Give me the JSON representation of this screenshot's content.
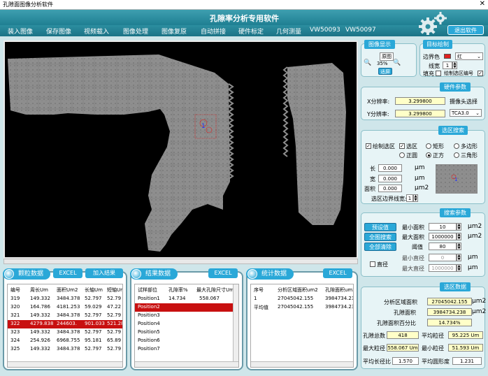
{
  "window": {
    "title": "孔隙面图像分析软件",
    "close": "✕"
  },
  "header": {
    "title": "孔隙率分析专用软件"
  },
  "menu": [
    "装入图像",
    "保存图像",
    "视频载入",
    "图像处理",
    "图像复原",
    "自动拼接",
    "硬件标定",
    "几何测量",
    "VW50093",
    "VW50097"
  ],
  "exit_button": "退出软件",
  "image_display": {
    "title": "图像显示",
    "orig": "原图",
    "zoom": "35%",
    "fit": "适屏"
  },
  "target_draw": {
    "title": "目标绘制",
    "border_color_label": "边界色",
    "border_color_value": "红",
    "border_color": "#e02020",
    "line_width_label": "线宽",
    "line_width_value": "1",
    "fill_label": "填充",
    "fill_checked": false,
    "draw_region_id_label": "绘制选区编号",
    "draw_region_id_checked": true
  },
  "hardware": {
    "title": "硬件参数",
    "x_res_label": "X分辨率:",
    "x_res": "3.299800",
    "y_res_label": "Y分辨率:",
    "y_res": "3.299800",
    "camera_label": "摄像头选择",
    "camera_value": "TCA3.0"
  },
  "region_select": {
    "title": "选区搜索",
    "draw_region": "绘制选区",
    "draw_region_checked": true,
    "region": "选区",
    "region_checked": true,
    "rect": "矩形",
    "polygon": "多边形",
    "circle": "正圆",
    "square": "正方",
    "triangle": "三角形",
    "length_label": "长",
    "length": "0.000",
    "width_label": "宽",
    "width": "0.000",
    "area_label": "面积",
    "area": "0.000",
    "unit_um": "μm",
    "unit_um2": "μm2",
    "border_line_label": "选区边界线宽:",
    "border_line_value": "1"
  },
  "search_params": {
    "title": "搜索参数",
    "preset_btn": "预设值",
    "full_search_btn": "全图搜索",
    "clear_btn": "全部清除",
    "min_area_label": "最小面积",
    "min_area": "10",
    "max_area_label": "最大面积",
    "max_area": "1000000",
    "threshold_label": "阈值",
    "threshold": "80",
    "diameter_label": "直径",
    "diameter_checked": false,
    "min_diam_label": "最小直径",
    "min_diam": "0",
    "max_diam_label": "最大直径",
    "max_diam": "1000000",
    "unit_um2": "μm2",
    "unit_um": "μm"
  },
  "region_data": {
    "title": "选区数据",
    "analysis_area_label": "分析区域面积",
    "analysis_area": "27045042.155",
    "pore_area_label": "孔隙面积",
    "pore_area": "3984734.238",
    "pore_pct_label": "孔隙面积百分比",
    "pore_pct": "14.734%",
    "pore_count_label": "孔隙总数",
    "pore_count": "418",
    "avg_size_label": "平均粒径",
    "avg_size": "95.225 Um",
    "max_size_label": "最大粒径",
    "max_size": "558.067 Um",
    "min_size_label": "最小粒径",
    "min_size": "51.593 Um",
    "avg_aspect_label": "平均长径比",
    "avg_aspect": "1.570",
    "avg_round_label": "平均圆形度",
    "avg_round": "1.231",
    "unit_um2": "μm2"
  },
  "particle_data": {
    "title": "颗粒数据",
    "excel_btn": "EXCEL",
    "add_btn": "加入结果",
    "headers": [
      "编号",
      "周长Um",
      "面积Um2",
      "长轴Um",
      "短轴Um"
    ],
    "rows": [
      [
        "319",
        "149.332",
        "3484.378",
        "52.797",
        "52.79"
      ],
      [
        "320",
        "164.786",
        "4181.253",
        "59.029",
        "47.22"
      ],
      [
        "321",
        "149.332",
        "3484.378",
        "52.797",
        "52.79"
      ],
      [
        "322",
        "4279.838",
        "244603.",
        "901.033",
        "521.28"
      ],
      [
        "323",
        "149.332",
        "3484.378",
        "52.797",
        "52.79"
      ],
      [
        "324",
        "254.926",
        "6968.755",
        "95.181",
        "65.89"
      ],
      [
        "325",
        "149.332",
        "3484.378",
        "52.797",
        "52.79"
      ]
    ],
    "selected_row": 3
  },
  "result_data": {
    "title": "结果数据",
    "excel_btn": "EXCEL",
    "headers": [
      "试样部位",
      "孔隙率%",
      "最大孔隙尺寸Um"
    ],
    "rows": [
      [
        "Position1",
        "14.734",
        "558.067"
      ],
      [
        "Position2",
        "",
        ""
      ],
      [
        "Position3",
        "",
        ""
      ],
      [
        "Position4",
        "",
        ""
      ],
      [
        "Position5",
        "",
        ""
      ],
      [
        "Position6",
        "",
        ""
      ],
      [
        "Position7",
        "",
        ""
      ]
    ],
    "selected_row": 1
  },
  "stat_data": {
    "title": "统计数据",
    "excel_btn": "EXCEL",
    "headers": [
      "序号",
      "分析区域面积um2",
      "孔隙面积um2"
    ],
    "rows": [
      [
        "1",
        "27045042.155",
        "3984734.238"
      ],
      [
        "平均值",
        "27045042.155",
        "3984734.238"
      ]
    ]
  },
  "colors": {
    "accent": "#2aa8d8",
    "header": "#1f7f92",
    "selected_row": "#c81010"
  }
}
